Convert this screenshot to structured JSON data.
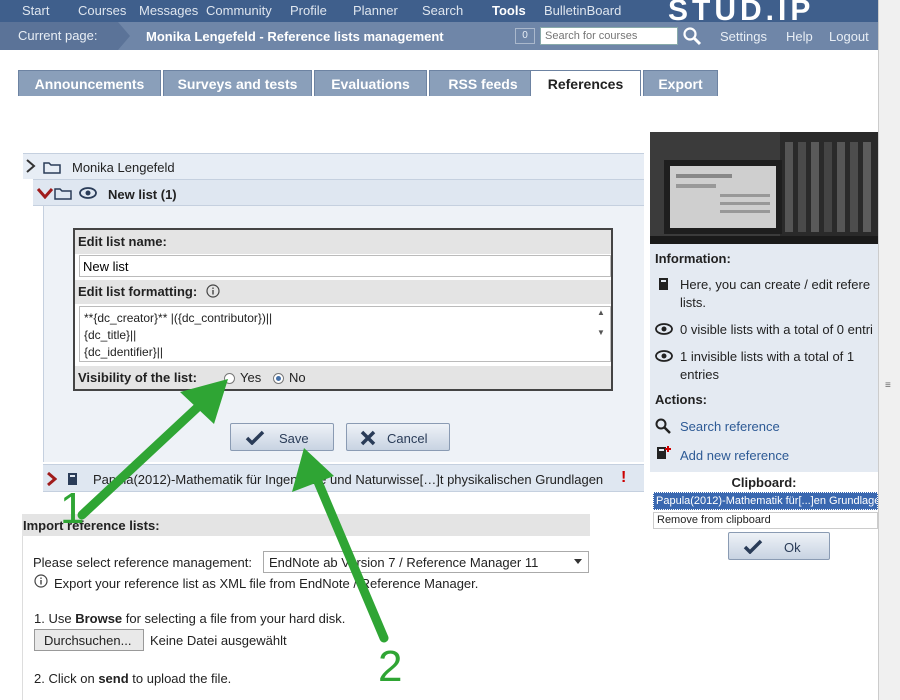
{
  "topnav": {
    "items": [
      "Start",
      "Courses",
      "Messages",
      "Community",
      "Profile",
      "Planner",
      "Search",
      "Tools",
      "BulletinBoard"
    ],
    "active": "Tools",
    "logo": "STUD.IP"
  },
  "crumbbar": {
    "current_label": "Current page:",
    "page_title": "Monika Lengefeld - Reference lists management",
    "badge": "0",
    "search_placeholder": "Search for courses",
    "settings": "Settings",
    "help": "Help",
    "logout": "Logout"
  },
  "tabs": [
    "Announcements",
    "Surveys and tests",
    "Evaluations",
    "RSS feeds",
    "References",
    "Export"
  ],
  "active_tab": "References",
  "tree": {
    "root_label": "Monika Lengefeld",
    "list_label": "New list (1)"
  },
  "edit": {
    "name_header": "Edit list name:",
    "name_value": "New list",
    "format_header": "Edit list formatting:",
    "format_lines": [
      "**{dc_creator}** |({dc_contributor})||",
      "{dc_title}||",
      "{dc_identifier}||"
    ],
    "visibility_label": "Visibility of the list:",
    "yes": "Yes",
    "no": "No",
    "selected": "No"
  },
  "buttons": {
    "save": "Save",
    "cancel": "Cancel",
    "ok": "Ok"
  },
  "reference_row": "Papula(2012)-Mathematik für Ingenieure und Naturwisse[…]t physikalischen Grundlagen",
  "import": {
    "header": "Import reference lists:",
    "select_label": "Please select reference management:",
    "select_value": "EndNote ab Version 7 / Reference Manager 11",
    "export_hint": "Export your reference list as XML file from EndNote / Reference Manager.",
    "step1_pre": "1. Use ",
    "step1_bold": "Browse",
    "step1_post": " for selecting a file from your hard disk.",
    "browse_button": "Durchsuchen...",
    "no_file": "Keine Datei ausgewählt",
    "step2_pre": "2. Click on ",
    "step2_bold": "send",
    "step2_post": " to upload the file."
  },
  "sidebar": {
    "info_header": "Information:",
    "info_text_1": "Here, you can create / edit refere",
    "info_text_2": "lists.",
    "visible_lists": "0 visible lists with a total of 0 entri",
    "invisible_lists_1": "1 invisible lists with a total of 1",
    "invisible_lists_2": "entries",
    "actions_header": "Actions:",
    "search_reference": "Search reference",
    "add_reference": "Add new reference",
    "clipboard_header": "Clipboard:",
    "clipboard_selected": "Papula(2012)-Mathematik für[...]en Grundlage",
    "clipboard_option": "Remove from clipboard"
  },
  "annotations": {
    "one": "1",
    "two": "2",
    "color": "#2fa534"
  },
  "colors": {
    "nav": "#3f5f8c",
    "tab": "#8a9fba",
    "link": "#2d5a95",
    "expand_arrow": "#a01c1c",
    "warning": "#cc0000"
  }
}
